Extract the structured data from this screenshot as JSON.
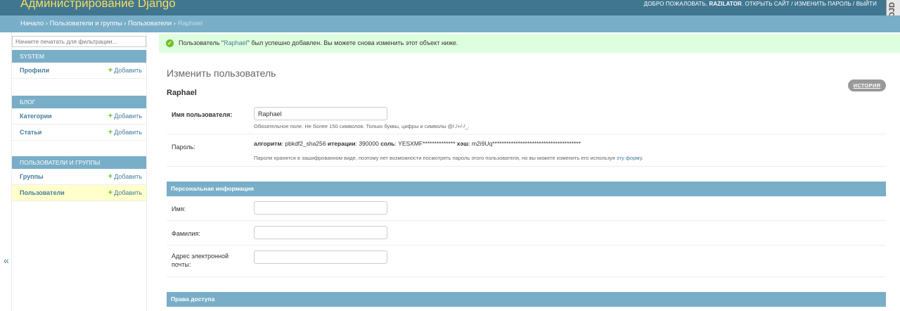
{
  "header": {
    "site_title": "Администрирование Django",
    "welcome": "ДОБРО ПОЖАЛОВАТЬ,",
    "username": "RAZILATOR",
    "view_site": "ОТКРЫТЬ САЙТ",
    "change_password": "ИЗМЕНИТЬ ПАРОЛЬ",
    "logout": "ВЫЙТИ",
    "corner_badge": "DJD"
  },
  "breadcrumbs": {
    "home": "Начало",
    "app": "Пользователи и группы",
    "model": "Пользователи",
    "current": "Raphael",
    "separator": "›"
  },
  "sidebar": {
    "filter_placeholder": "Начните печатать для фильтрации...",
    "collapse_glyph": "«",
    "modules": [
      {
        "caption": "SYSTEM",
        "rows": [
          {
            "name": "Профили",
            "add": "Добавить"
          }
        ]
      },
      {
        "caption": "БЛОГ",
        "rows": [
          {
            "name": "Категории",
            "add": "Добавить"
          },
          {
            "name": "Статьи",
            "add": "Добавить"
          }
        ]
      },
      {
        "caption": "ПОЛЬЗОВАТЕЛИ И ГРУППЫ",
        "rows": [
          {
            "name": "Группы",
            "add": "Добавить"
          },
          {
            "name": "Пользователи",
            "add": "Добавить"
          }
        ]
      }
    ]
  },
  "message": {
    "prefix": "Пользователь \"",
    "link": "Raphael",
    "suffix": "\" был успешно добавлен. Вы можете снова изменить этот объект ниже."
  },
  "content": {
    "title": "Изменить пользователь",
    "object_name": "Raphael",
    "history_button": "ИСТОРИЯ"
  },
  "form": {
    "username": {
      "label": "Имя пользователя:",
      "value": "Raphael",
      "help": "Обязательное поле. Не более 150 символов. Только буквы, цифры и символы @/./+/-/_."
    },
    "password": {
      "label": "Пароль:",
      "algorithm_label": "алгоритм",
      "algorithm": "pbkdf2_sha256",
      "iterations_label": "итерации",
      "iterations": "390000",
      "salt_label": "соль",
      "salt": "YESXMF**************",
      "hash_label": "хэш",
      "hash": "m2i9Uq**************************************",
      "help_prefix": "Пароли хранятся в зашифрованном виде, поэтому нет возможности посмотреть пароль этого пользователя, но вы можете изменить его используя ",
      "help_link": "эту форму",
      "help_suffix": "."
    },
    "personal_caption": "Персональная информация",
    "first_name": {
      "label": "Имя:",
      "value": ""
    },
    "last_name": {
      "label": "Фамилия:",
      "value": ""
    },
    "email": {
      "label": "Адрес электронной почты:",
      "value": ""
    },
    "permissions_caption": "Права доступа"
  },
  "colors": {
    "header": "#417690",
    "breadcrumbs": "#79aec8",
    "title_yellow": "#f5dd5d",
    "success_bg": "#dfdfdf",
    "link": "#447e9b",
    "add_green": "#70bf2b"
  }
}
